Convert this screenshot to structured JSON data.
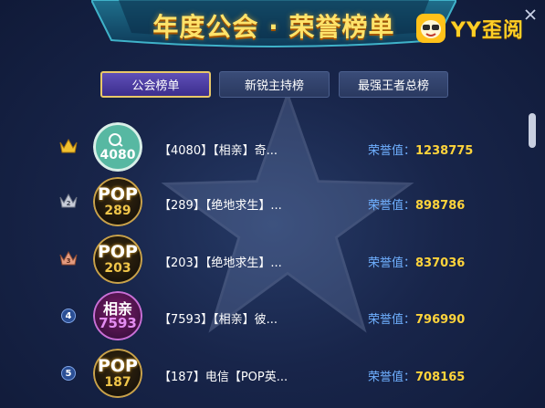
{
  "header": {
    "title": "年度公会 · 荣誉榜单",
    "logo_text": "YY歪阅"
  },
  "tabs": [
    {
      "label": "公会榜单",
      "active": true
    },
    {
      "label": "新锐主持榜",
      "active": false
    },
    {
      "label": "最强王者总榜",
      "active": false
    }
  ],
  "rows": [
    {
      "rank": "1",
      "rank_icon": "gold-crown-icon",
      "avatar": {
        "type": "qq",
        "top": "",
        "num": "4080"
      },
      "name": "【4080】【相亲】奇...",
      "score_label": "荣誉值：",
      "score": "1238775"
    },
    {
      "rank": "2",
      "rank_icon": "silver-crown-icon",
      "avatar": {
        "type": "pop",
        "top": "POP",
        "num": "289"
      },
      "name": "【289】【绝地求生】...",
      "score_label": "荣誉值：",
      "score": "898786"
    },
    {
      "rank": "3",
      "rank_icon": "bronze-crown-icon",
      "avatar": {
        "type": "pop",
        "top": "POP",
        "num": "203"
      },
      "name": "【203】【绝地求生】...",
      "score_label": "荣誉值：",
      "score": "837036"
    },
    {
      "rank": "4",
      "rank_icon": "",
      "avatar": {
        "type": "xq",
        "top": "相亲",
        "num": "7593"
      },
      "name": "【7593】【相亲】彼...",
      "score_label": "荣誉值：",
      "score": "796990"
    },
    {
      "rank": "5",
      "rank_icon": "",
      "avatar": {
        "type": "pop",
        "top": "POP",
        "num": "187"
      },
      "name": "【187】电信【POP英...",
      "score_label": "荣誉值：",
      "score": "708165"
    }
  ],
  "colors": {
    "accent_gold": "#ffd43b",
    "score_label_blue": "#6fb0ff",
    "tab_active_border": "#e9c868"
  }
}
